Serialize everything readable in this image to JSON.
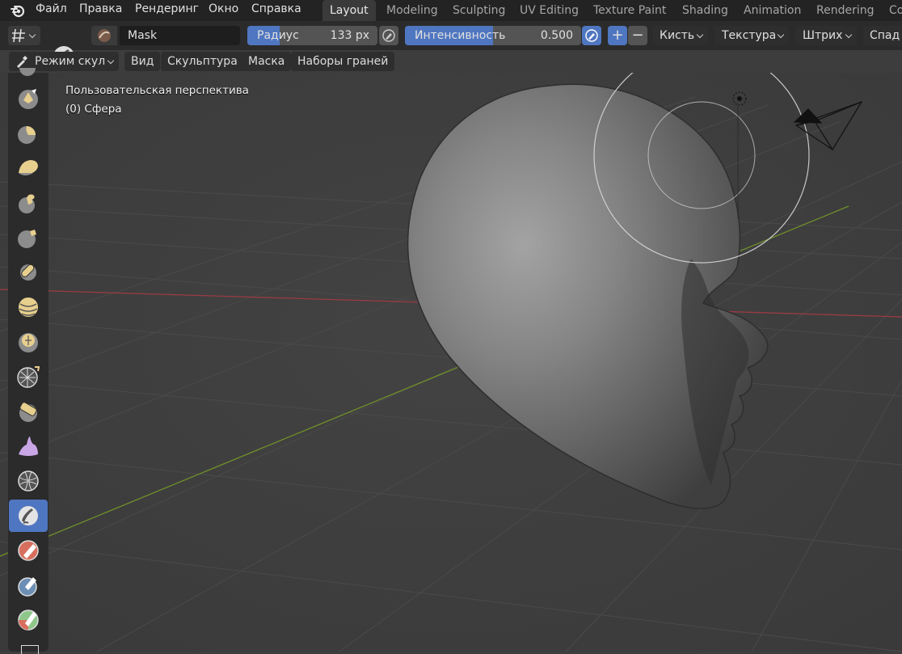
{
  "menu": {
    "items": [
      "Файл",
      "Правка",
      "Рендеринг",
      "Окно",
      "Справка"
    ]
  },
  "workspaces": {
    "tabs": [
      "Layout",
      "Modeling",
      "Sculpting",
      "UV Editing",
      "Texture Paint",
      "Shading",
      "Animation",
      "Rendering",
      "Co"
    ],
    "active": "Layout"
  },
  "toolheader": {
    "brush_name": "Mask",
    "radius_label": "Радиус",
    "radius_value": "133 px",
    "strength_label": "Интенсивность",
    "strength_value": "0.500",
    "strength_fraction": 0.5,
    "add_symbol": "+",
    "subtract_symbol": "−",
    "brush_menu": "Кисть",
    "texture_menu": "Текстура",
    "stroke_menu": "Штрих",
    "falloff_menu": "Спад"
  },
  "viewport_header": {
    "mode": "Режим скул",
    "menus": [
      "Вид",
      "Скульптура",
      "Маска",
      "Наборы граней"
    ]
  },
  "overlay": {
    "view_name": "Пользовательская перспектива",
    "object_name": "(0) Сфера"
  },
  "tools": [
    "draw-sharp",
    "clay",
    "clay-strips",
    "clay-thumb",
    "layer",
    "inflate",
    "blob",
    "crease",
    "smooth",
    "flatten",
    "fill",
    "scrape",
    "multiplane-scrape",
    "pinch",
    "grab",
    "elastic-deform",
    "snake-hook",
    "thumb",
    "pose",
    "nudge",
    "rotate",
    "slide-relax",
    "cloth",
    "simplify",
    "mask",
    "draw-face-sets",
    "box-mask",
    "lasso-mask",
    "mesh-filter"
  ],
  "active_tool": "mask",
  "colors": {
    "accent": "#4f76c0",
    "axis_x": "#9c3b44",
    "axis_y": "#6f8f2a",
    "brush_yellow": "#e7cf8e"
  }
}
